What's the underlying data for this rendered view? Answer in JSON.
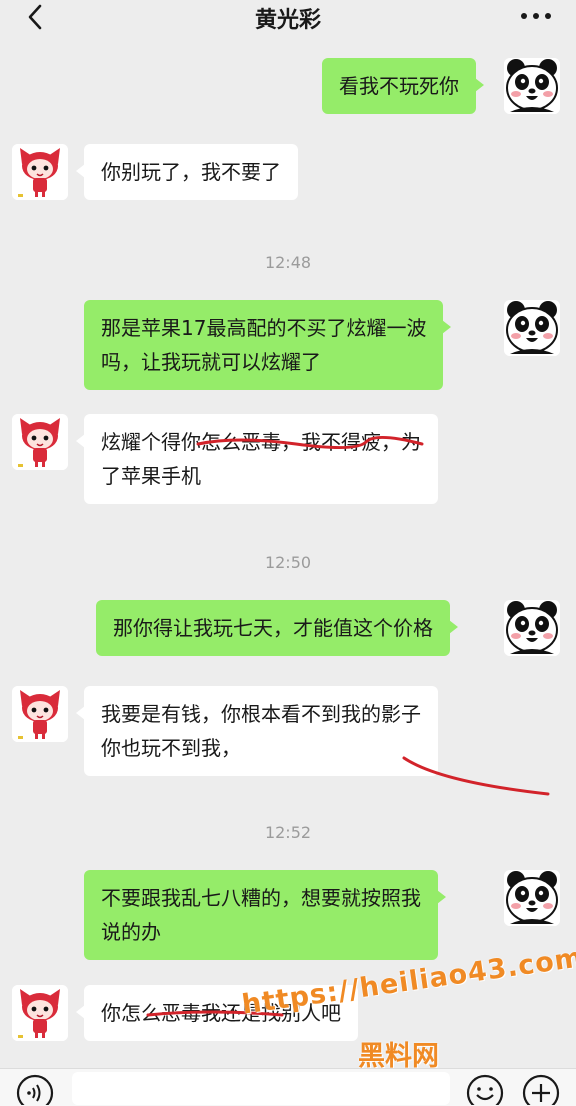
{
  "header": {
    "title": "黄光彩"
  },
  "messages": [
    {
      "side": "sent",
      "lines": [
        "看我不玩死你"
      ]
    },
    {
      "side": "recv",
      "lines": [
        "你别玩了，我不要了"
      ]
    },
    {
      "time": "12:48"
    },
    {
      "side": "sent",
      "lines": [
        "那是苹果17最高配的不买了炫耀一波",
        "吗，让我玩就可以炫耀了"
      ]
    },
    {
      "side": "recv",
      "lines": [
        "炫耀个得你怎么恶毒，我不得疲，为",
        "了苹果手机"
      ]
    },
    {
      "time": "12:50"
    },
    {
      "side": "sent",
      "lines": [
        "那你得让我玩七天，才能值这个价格"
      ]
    },
    {
      "side": "recv",
      "lines": [
        "我要是有钱，你根本看不到我的影子",
        "你也玩不到我，"
      ]
    },
    {
      "time": "12:52"
    },
    {
      "side": "sent",
      "lines": [
        "不要跟我乱七八糟的，想要就按照我",
        "说的办"
      ]
    },
    {
      "side": "recv",
      "lines": [
        "你怎么恶毒我还是找别人吧"
      ]
    }
  ],
  "watermark": {
    "url": "https://heiliao43.com",
    "name": "黑料网"
  },
  "icons": [
    "back-arrow-icon",
    "more-dots-icon",
    "voice-icon",
    "emoji-icon",
    "plus-icon"
  ],
  "colors": {
    "background": "#ededed",
    "sent_bubble": "#95ec69",
    "recv_bubble": "#ffffff",
    "annotation": "#d2232a",
    "watermark": "#f08a24"
  }
}
